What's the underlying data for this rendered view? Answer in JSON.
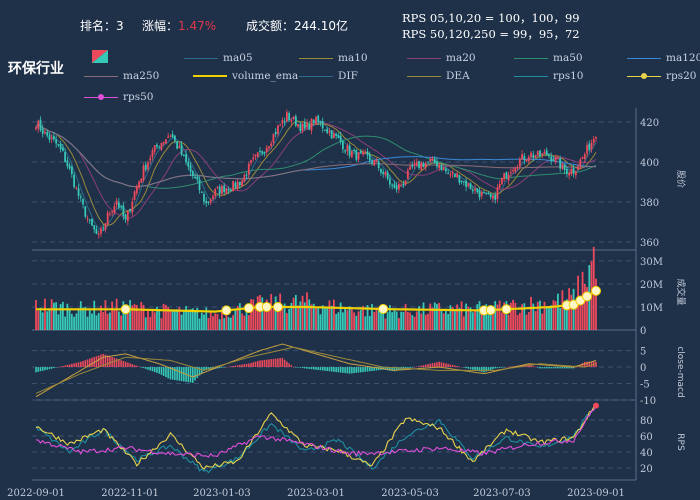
{
  "header": {
    "rank_label": "排名：",
    "rank_value": "3",
    "change_label": "涨幅：",
    "change_value": "1.47%",
    "turnover_label": "成交额：",
    "turnover_value": "244.10亿",
    "rps_line1": "RPS 05,10,20 = 100，100，99",
    "rps_line2": "RPS 50,120,250 = 99，95，72"
  },
  "title": "环保行业",
  "legend": [
    {
      "label": "ma05",
      "color": "#2a6e8c",
      "style": "line"
    },
    {
      "label": "ma10",
      "color": "#9a8a3a",
      "style": "line"
    },
    {
      "label": "ma20",
      "color": "#8a3e7a",
      "style": "line"
    },
    {
      "label": "ma50",
      "color": "#2f8f6f",
      "style": "line"
    },
    {
      "label": "ma120",
      "color": "#3a8ad8",
      "style": "line"
    },
    {
      "label": "ma250",
      "color": "#8a6f7a",
      "style": "line"
    },
    {
      "label": "volume_ema",
      "color": "#f0d000",
      "style": "thick"
    },
    {
      "label": "DIF",
      "color": "#2a6e8c",
      "style": "line"
    },
    {
      "label": "DEA",
      "color": "#9a8a3a",
      "style": "line"
    },
    {
      "label": "rps10",
      "color": "#1e8fa0",
      "style": "line"
    },
    {
      "label": "rps20",
      "color": "#e8d24a",
      "style": "dot"
    },
    {
      "label": "rps50",
      "color": "#e04fd8",
      "style": "dot"
    }
  ],
  "colors": {
    "up": "#ee4a5c",
    "down": "#36c9b7",
    "background": "#1f3049",
    "grid": "#3c5272"
  },
  "chart_data": [
    {
      "type": "candlestick",
      "panel": "price",
      "ylabel": "股价",
      "ylim": [
        356,
        427
      ],
      "yticks": [
        360,
        380,
        400,
        420
      ],
      "x_ticks": [
        "2022-09-01",
        "2022-11-01",
        "2023-01-03",
        "2023-03-01",
        "2023-05-03",
        "2023-07-03",
        "2023-09-01"
      ],
      "close_anchors": [
        [
          0,
          420
        ],
        [
          4,
          414
        ],
        [
          9,
          409
        ],
        [
          12,
          404
        ],
        [
          16,
          393
        ],
        [
          20,
          380
        ],
        [
          24,
          369
        ],
        [
          28,
          362
        ],
        [
          32,
          373
        ],
        [
          36,
          381
        ],
        [
          40,
          370
        ],
        [
          44,
          385
        ],
        [
          48,
          396
        ],
        [
          52,
          405
        ],
        [
          56,
          410
        ],
        [
          60,
          414
        ],
        [
          64,
          406
        ],
        [
          68,
          397
        ],
        [
          72,
          389
        ],
        [
          76,
          379
        ],
        [
          80,
          385
        ],
        [
          84,
          387
        ],
        [
          88,
          388
        ],
        [
          92,
          391
        ],
        [
          96,
          399
        ],
        [
          100,
          404
        ],
        [
          104,
          410
        ],
        [
          108,
          417
        ],
        [
          112,
          423
        ],
        [
          116,
          420
        ],
        [
          120,
          416
        ],
        [
          124,
          421
        ],
        [
          128,
          418
        ],
        [
          132,
          414
        ],
        [
          136,
          410
        ],
        [
          140,
          405
        ],
        [
          144,
          403
        ],
        [
          148,
          402
        ],
        [
          152,
          399
        ],
        [
          156,
          393
        ],
        [
          160,
          386
        ],
        [
          164,
          390
        ],
        [
          168,
          397
        ],
        [
          172,
          399
        ],
        [
          176,
          400
        ],
        [
          180,
          399
        ],
        [
          184,
          394
        ],
        [
          188,
          393
        ],
        [
          192,
          389
        ],
        [
          196,
          386
        ],
        [
          200,
          383
        ],
        [
          204,
          381
        ],
        [
          208,
          391
        ],
        [
          212,
          397
        ],
        [
          216,
          401
        ],
        [
          220,
          404
        ],
        [
          224,
          403
        ],
        [
          228,
          404
        ],
        [
          232,
          401
        ],
        [
          236,
          396
        ],
        [
          240,
          396
        ],
        [
          244,
          402
        ],
        [
          248,
          410
        ],
        [
          250,
          415
        ]
      ]
    },
    {
      "type": "bar",
      "panel": "volume",
      "ylabel": "成交量",
      "ylim": [
        0,
        33
      ],
      "yticks": [
        "0",
        "10M",
        "20M",
        "30M"
      ],
      "volume_anchors": [
        [
          0,
          11
        ],
        [
          20,
          9
        ],
        [
          40,
          10
        ],
        [
          60,
          8
        ],
        [
          80,
          7
        ],
        [
          100,
          11
        ],
        [
          120,
          12
        ],
        [
          140,
          9
        ],
        [
          160,
          8
        ],
        [
          180,
          9
        ],
        [
          200,
          9
        ],
        [
          220,
          11
        ],
        [
          230,
          12
        ],
        [
          240,
          14
        ],
        [
          245,
          22
        ],
        [
          248,
          29
        ],
        [
          250,
          33
        ]
      ],
      "ema_anchors": [
        [
          0,
          9
        ],
        [
          40,
          9
        ],
        [
          80,
          8
        ],
        [
          100,
          10
        ],
        [
          120,
          10
        ],
        [
          160,
          9
        ],
        [
          200,
          8.5
        ],
        [
          230,
          10
        ],
        [
          240,
          11
        ],
        [
          250,
          17
        ]
      ]
    },
    {
      "type": "bar",
      "panel": "macd",
      "ylabel": "close-macd",
      "ylim": [
        -10,
        7
      ],
      "yticks": [
        -10,
        -5,
        0,
        5
      ],
      "dif_anchors": [
        [
          0,
          -9
        ],
        [
          15,
          -3
        ],
        [
          30,
          3
        ],
        [
          40,
          4
        ],
        [
          55,
          1
        ],
        [
          70,
          -3
        ],
        [
          85,
          1
        ],
        [
          100,
          5
        ],
        [
          110,
          7
        ],
        [
          125,
          4
        ],
        [
          140,
          1
        ],
        [
          160,
          -1
        ],
        [
          180,
          0
        ],
        [
          200,
          -2
        ],
        [
          220,
          1
        ],
        [
          240,
          0
        ],
        [
          250,
          2
        ]
      ],
      "dea_anchors": [
        [
          0,
          -8
        ],
        [
          20,
          -2
        ],
        [
          40,
          3
        ],
        [
          60,
          2
        ],
        [
          75,
          -1
        ],
        [
          95,
          3
        ],
        [
          115,
          6
        ],
        [
          135,
          3
        ],
        [
          155,
          0
        ],
        [
          180,
          -1
        ],
        [
          205,
          -1
        ],
        [
          225,
          1
        ],
        [
          245,
          0
        ],
        [
          250,
          1
        ]
      ]
    },
    {
      "type": "line",
      "panel": "rps",
      "ylabel": "RPS",
      "ylim": [
        5,
        100
      ],
      "yticks": [
        20,
        40,
        60,
        80
      ],
      "series": [
        {
          "name": "rps10",
          "anchors": [
            [
              0,
              70
            ],
            [
              15,
              40
            ],
            [
              30,
              68
            ],
            [
              45,
              30
            ],
            [
              60,
              48
            ],
            [
              75,
              15
            ],
            [
              90,
              32
            ],
            [
              105,
              75
            ],
            [
              120,
              40
            ],
            [
              135,
              55
            ],
            [
              150,
              20
            ],
            [
              165,
              60
            ],
            [
              180,
              80
            ],
            [
              195,
              32
            ],
            [
              210,
              58
            ],
            [
              225,
              45
            ],
            [
              240,
              60
            ],
            [
              250,
              100
            ]
          ]
        },
        {
          "name": "rps20",
          "anchors": [
            [
              0,
              72
            ],
            [
              15,
              50
            ],
            [
              30,
              68
            ],
            [
              45,
              25
            ],
            [
              60,
              62
            ],
            [
              75,
              20
            ],
            [
              90,
              28
            ],
            [
              105,
              88
            ],
            [
              120,
              48
            ],
            [
              135,
              42
            ],
            [
              150,
              22
            ],
            [
              165,
              82
            ],
            [
              180,
              70
            ],
            [
              195,
              28
            ],
            [
              210,
              68
            ],
            [
              225,
              52
            ],
            [
              240,
              58
            ],
            [
              250,
              100
            ]
          ]
        },
        {
          "name": "rps50",
          "anchors": [
            [
              0,
              55
            ],
            [
              20,
              40
            ],
            [
              40,
              45
            ],
            [
              60,
              38
            ],
            [
              80,
              35
            ],
            [
              100,
              60
            ],
            [
              120,
              50
            ],
            [
              140,
              38
            ],
            [
              160,
              40
            ],
            [
              180,
              45
            ],
            [
              200,
              38
            ],
            [
              220,
              50
            ],
            [
              240,
              55
            ],
            [
              250,
              99
            ]
          ]
        }
      ]
    }
  ]
}
